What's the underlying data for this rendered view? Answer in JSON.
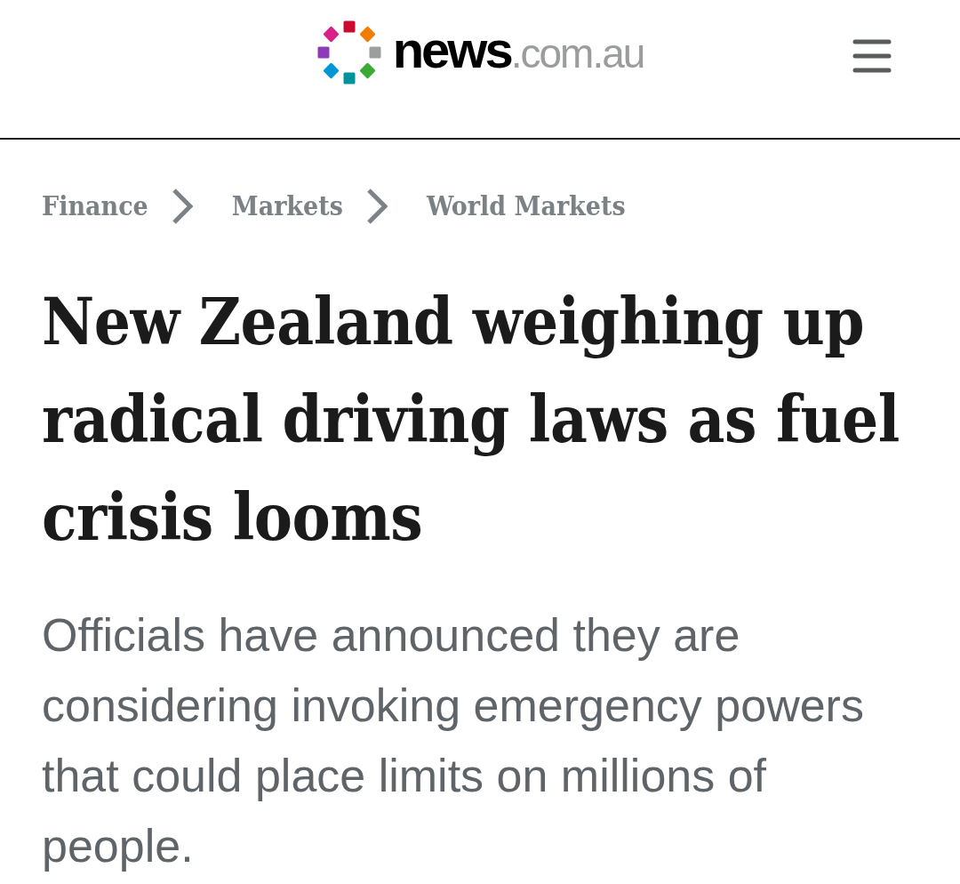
{
  "header": {
    "logo_text": "**news**.com.au"
  },
  "breadcrumbs": [
    {
      "label": "Finance"
    },
    {
      "label": "Markets"
    },
    {
      "label": "World Markets"
    }
  ],
  "headline": "New Zealand weighing up radical driving laws as fuel crisis looms",
  "standfirst": "Officials have announced they are considering invoking emergency powers that could place limits on millions of people."
}
